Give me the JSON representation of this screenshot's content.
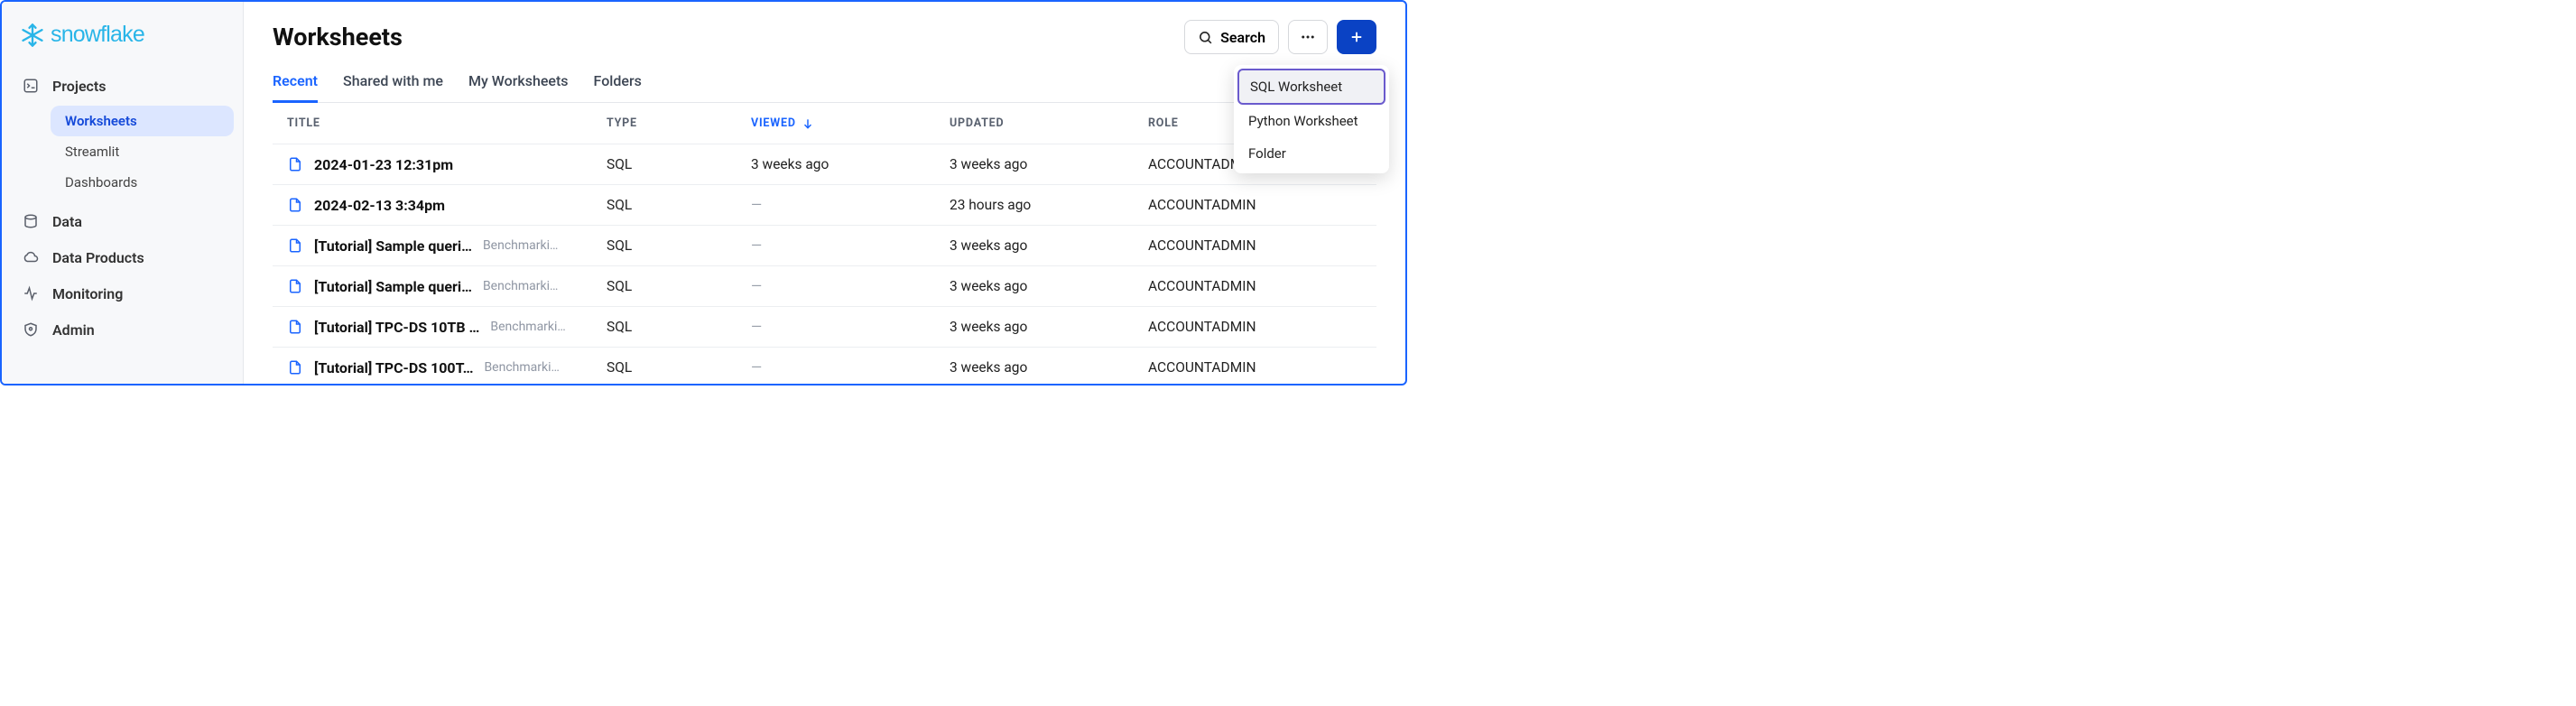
{
  "brand": {
    "name": "snowflake"
  },
  "sidebar": {
    "items": [
      {
        "label": "Projects"
      },
      {
        "label": "Data"
      },
      {
        "label": "Data Products"
      },
      {
        "label": "Monitoring"
      },
      {
        "label": "Admin"
      }
    ],
    "projects_sub": [
      {
        "label": "Worksheets"
      },
      {
        "label": "Streamlit"
      },
      {
        "label": "Dashboards"
      }
    ]
  },
  "header": {
    "title": "Worksheets",
    "search_label": "Search"
  },
  "tabs": [
    {
      "label": "Recent"
    },
    {
      "label": "Shared with me"
    },
    {
      "label": "My Worksheets"
    },
    {
      "label": "Folders"
    }
  ],
  "columns": {
    "title": "TITLE",
    "type": "TYPE",
    "viewed": "VIEWED",
    "updated": "UPDATED",
    "role": "ROLE"
  },
  "rows": [
    {
      "title": "2024-01-23 12:31pm",
      "subtitle": "",
      "type": "SQL",
      "viewed": "3 weeks ago",
      "updated": "3 weeks ago",
      "role": "ACCOUNTADMIN"
    },
    {
      "title": "2024-02-13 3:34pm",
      "subtitle": "",
      "type": "SQL",
      "viewed": "—",
      "updated": "23 hours ago",
      "role": "ACCOUNTADMIN"
    },
    {
      "title": "[Tutorial] Sample queri…",
      "subtitle": "Benchmarki…",
      "type": "SQL",
      "viewed": "—",
      "updated": "3 weeks ago",
      "role": "ACCOUNTADMIN"
    },
    {
      "title": "[Tutorial] Sample queri…",
      "subtitle": "Benchmarki…",
      "type": "SQL",
      "viewed": "—",
      "updated": "3 weeks ago",
      "role": "ACCOUNTADMIN"
    },
    {
      "title": "[Tutorial] TPC-DS 10TB …",
      "subtitle": "Benchmarki…",
      "type": "SQL",
      "viewed": "—",
      "updated": "3 weeks ago",
      "role": "ACCOUNTADMIN"
    },
    {
      "title": "[Tutorial] TPC-DS 100T…",
      "subtitle": "Benchmarki…",
      "type": "SQL",
      "viewed": "—",
      "updated": "3 weeks ago",
      "role": "ACCOUNTADMIN"
    }
  ],
  "dropdown": {
    "items": [
      {
        "label": "SQL Worksheet"
      },
      {
        "label": "Python Worksheet"
      },
      {
        "label": "Folder"
      }
    ]
  }
}
